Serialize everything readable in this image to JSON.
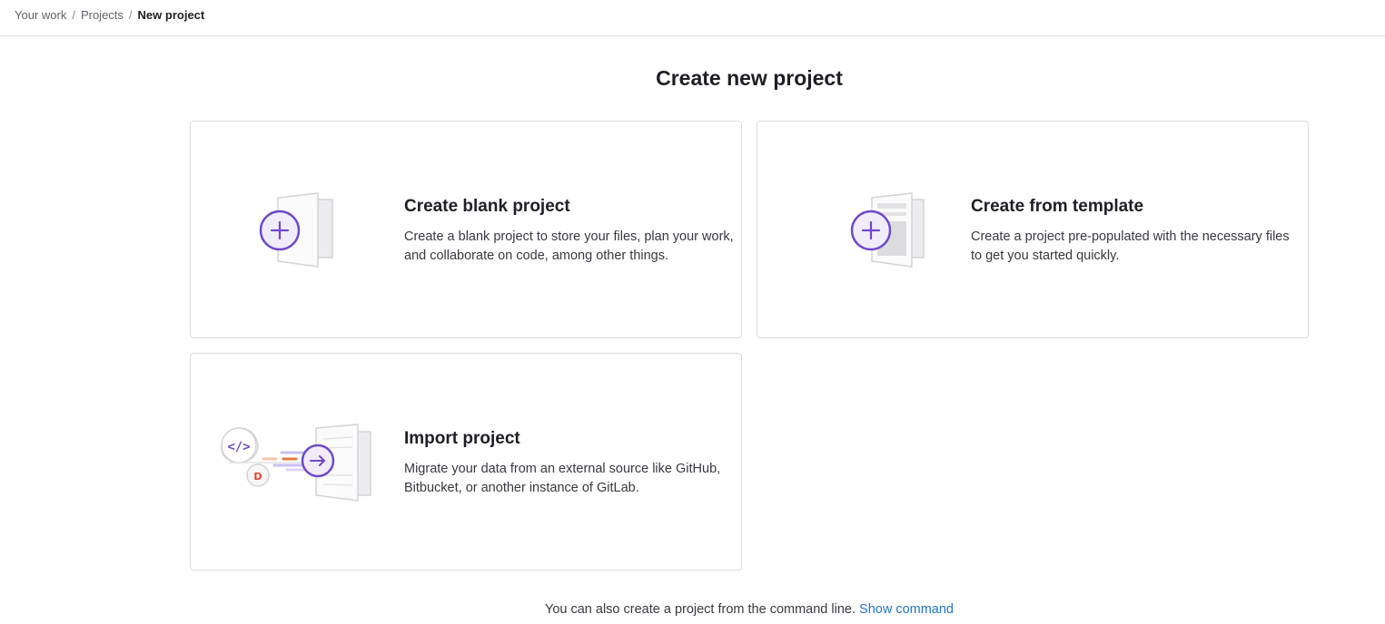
{
  "breadcrumb": {
    "items": [
      "Your work",
      "Projects"
    ],
    "current": "New project",
    "separator": "/"
  },
  "page": {
    "title": "Create new project"
  },
  "cards": [
    {
      "title": "Create blank project",
      "description": "Create a blank project to store your files, plan your work, and collaborate on code, among other things."
    },
    {
      "title": "Create from template",
      "description": "Create a project pre-populated with the necessary files to get you started quickly."
    },
    {
      "title": "Import project",
      "description": "Migrate your data from an external source like GitHub, Bitbucket, or another instance of GitLab."
    }
  ],
  "footer": {
    "text": "You can also create a project from the command line.",
    "link": "Show command"
  },
  "colors": {
    "accent_purple": "#6e49cb",
    "link_blue": "#1f75cb",
    "orange": "#e24329"
  }
}
